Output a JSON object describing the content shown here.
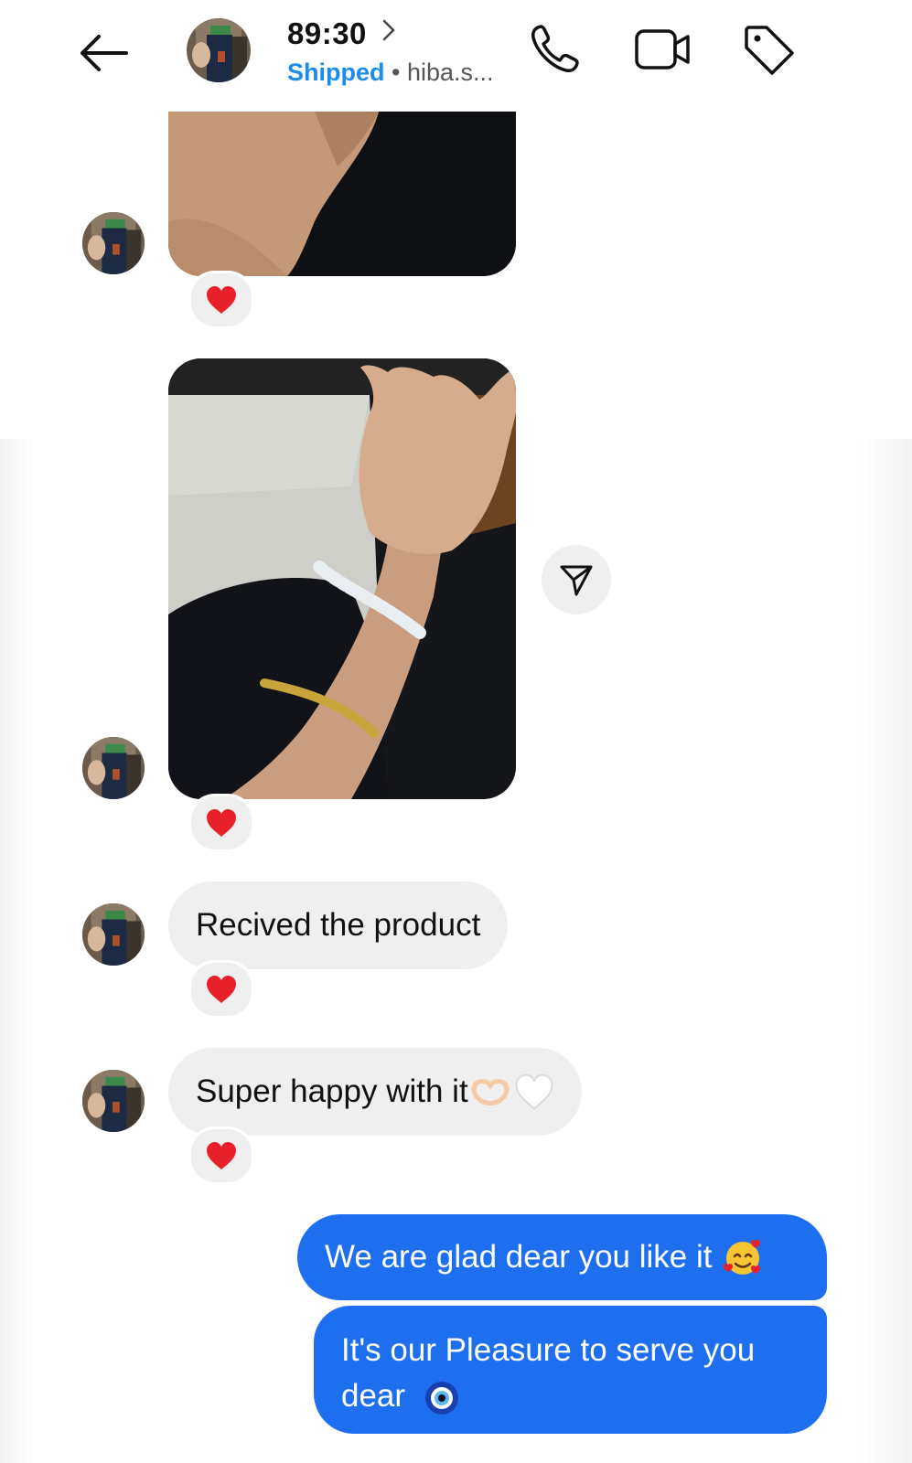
{
  "header": {
    "title": "89:30",
    "status": "Shipped",
    "separator": "•",
    "username": "hiba.s..."
  },
  "messages": {
    "in_text_1": "Recived the product",
    "in_text_2": "Super happy with it",
    "out_text_1": "We are glad dear you like it",
    "out_text_2": "It's our Pleasure to serve you dear"
  },
  "icons": {
    "back": "arrow-left-icon",
    "call": "phone-icon",
    "video": "video-camera-icon",
    "tag": "tag-icon",
    "share": "send-icon",
    "reaction": "red-heart-icon",
    "hands_heart": "heart-hands-emoji",
    "white_heart": "white-heart-emoji",
    "smiling_hearts": "smiling-face-with-hearts-emoji",
    "evil_eye": "nazar-amulet-emoji"
  },
  "colors": {
    "accent_status": "#1a8cf0",
    "outgoing_bubble": "#1e6ff0",
    "incoming_bubble": "#efefef",
    "reaction_heart": "#e8202a"
  }
}
